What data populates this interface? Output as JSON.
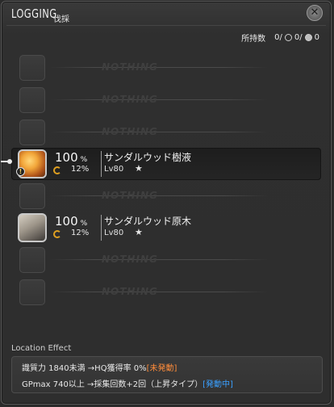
{
  "window": {
    "title": "LOGGING",
    "subtitle": "伐採",
    "close_glyph": "✕"
  },
  "inventory": {
    "label": "所持数",
    "normal_count": "0/",
    "hq_count": "0/",
    "crystal_count": "0"
  },
  "empty_text": "NOTHING",
  "items": [
    {
      "chance": "100",
      "pct_sign": "%",
      "hq_chance": "12%",
      "name": "サンダルウッド樹液",
      "level": "Lv80",
      "star": "★"
    },
    {
      "chance": "100",
      "pct_sign": "%",
      "hq_chance": "12%",
      "name": "サンダルウッド原木",
      "level": "Lv80",
      "star": "★"
    }
  ],
  "location_effect": {
    "label": "Location Effect",
    "line1_text": "識質力 1840未満 →HQ獲得率 0%",
    "line1_status": "[未発動]",
    "line2_text": "GPmax 740以上 →採集回数+2回（上昇タイプ）",
    "line2_status": "[発動中]"
  },
  "colors": {
    "inactive_status": "#ff8c3a",
    "active_status": "#3aa0ff"
  }
}
